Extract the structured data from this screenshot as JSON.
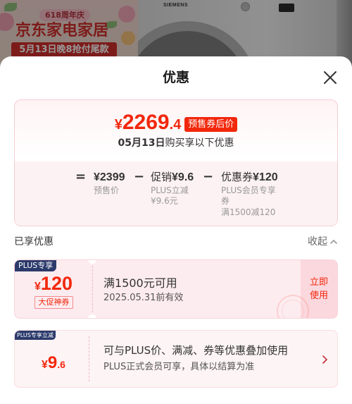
{
  "background": {
    "promo_banner": {
      "anniversary": "618周年庆",
      "title": "京东家电家居",
      "subtitle": "5月13日晚8抢付尾款"
    },
    "product": {
      "brand": "SIEMENS"
    }
  },
  "sheet": {
    "title": "优惠",
    "close_icon": "close-icon"
  },
  "price_card": {
    "currency": "¥",
    "price_int": "2269",
    "price_dec": ".4",
    "badge": "预售券后价",
    "date_highlight": "05月13日",
    "date_text": "购买享以下优惠",
    "breakdown": [
      {
        "op": "=",
        "amount": "¥2399",
        "labels": [
          "预售价"
        ]
      },
      {
        "op": "−",
        "prefix": "促销",
        "amount": "¥9.6",
        "labels": [
          "PLUS立减",
          "¥9.6元"
        ]
      },
      {
        "op": "−",
        "prefix": "优惠券",
        "amount": "¥120",
        "labels": [
          "PLUS会员专享",
          "券",
          "满1500减120"
        ]
      }
    ]
  },
  "applied_section": {
    "title": "已享优惠",
    "toggle_label": "收起",
    "toggle_icon": "chevron-up-icon"
  },
  "coupons": [
    {
      "badge": "PLUS专享",
      "currency": "¥",
      "amount": "120",
      "tag": "大促神券",
      "condition": "满1500元可用",
      "validity": "2025.05.31前有效",
      "action_lines": [
        "立即",
        "使用"
      ]
    },
    {
      "badge": "PLUS专享立减",
      "currency": "¥",
      "amount_int": "9",
      "amount_dec": ".6",
      "description": "可与PLUS价、满减、券等优惠叠加使用",
      "note": "PLUS正式会员可享，具体以结算为准",
      "action_icon": "chevron-right-icon"
    }
  ],
  "colors": {
    "accent_red": "#f2270c",
    "plus_navy": "#2b3a6b",
    "breakdown_bg": "#fdf2f3",
    "coupon_bg": "#fdecef"
  }
}
